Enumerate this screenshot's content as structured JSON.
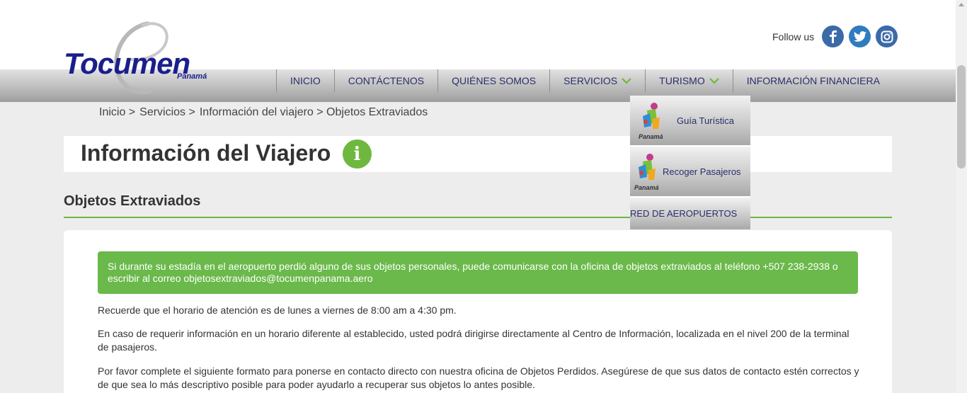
{
  "brand": {
    "name": "Tocumen",
    "sub": "Panamá"
  },
  "social": {
    "label": "Follow us",
    "icons": [
      "facebook-icon",
      "twitter-icon",
      "instagram-icon"
    ]
  },
  "nav": {
    "items": [
      {
        "label": "INICIO"
      },
      {
        "label": "CONTÁCTENOS"
      },
      {
        "label": "QUIÉNES SOMOS"
      },
      {
        "label": "SERVICIOS"
      },
      {
        "label": "TURISMO"
      },
      {
        "label": "INFORMACIÓN FINANCIERA"
      }
    ]
  },
  "dropdown": {
    "items": [
      {
        "label": "Guía Turística",
        "logo_text": "Panamá"
      },
      {
        "label": "Recoger Pasajeros",
        "logo_text": "Panamá"
      },
      {
        "label": "RED DE AEROPUERTOS"
      }
    ]
  },
  "breadcrumb": {
    "items": [
      "Inicio >",
      "Servicios >",
      "Información del viajero > Objetos Extraviados"
    ]
  },
  "page": {
    "title": "Información del Viajero",
    "info_glyph": "i",
    "section": "Objetos Extraviados"
  },
  "content": {
    "alert": "Si durante su estadía en el aeropuerto perdió alguno de sus objetos personales, puede comunicarse con la oficina de objetos extraviados al teléfono +507 238-2938 o escribir al correo objetosextraviados@tocumenpanama.aero",
    "p1": "Recuerde que el horario de atención es de lunes a viernes de 8:00 am a 4:30 pm.",
    "p2": "En caso de requerir información en un horario diferente al establecido, usted podrá dirigirse directamente al Centro de Información, localizada en el nivel 200 de la terminal de pasajeros.",
    "p3": "Por favor complete el siguiente formato para ponerse en contacto directo con nuestra oficina de Objetos Perdidos. Asegúrese de que sus datos de contacto estén correctos y de que sea lo más descriptivo posible para poder ayudarlo a recuperar sus objetos lo antes posible."
  },
  "colors": {
    "accent": "#6fb83f",
    "nav_text": "#2a2e6a",
    "brand": "#1a1f8c"
  }
}
